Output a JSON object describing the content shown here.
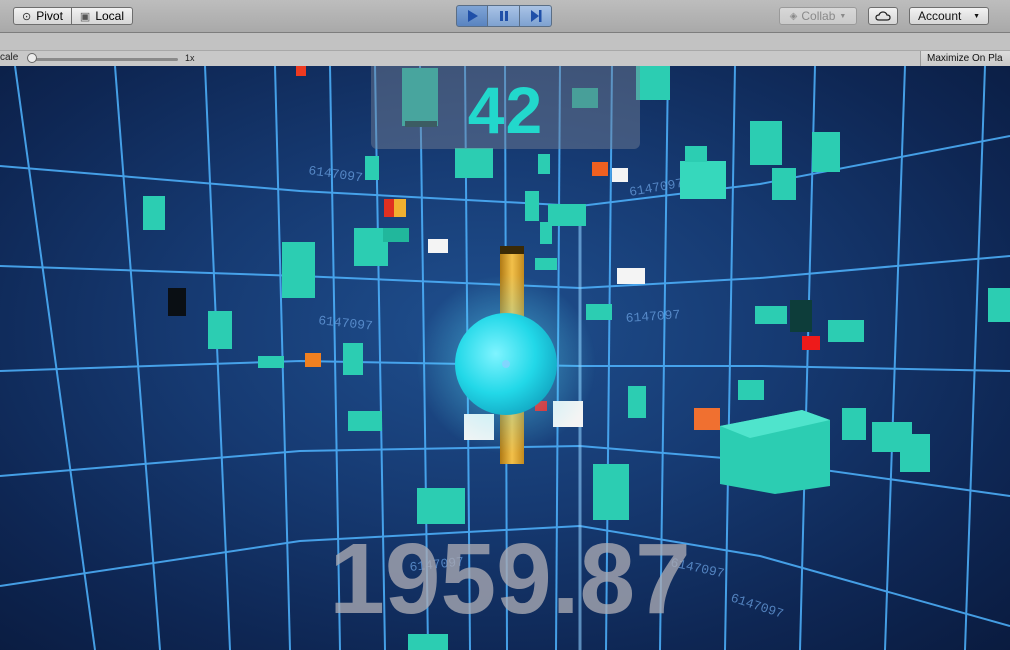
{
  "toolbar": {
    "pivot_label": "Pivot",
    "local_label": "Local",
    "play_icon": "play-icon",
    "pause_icon": "pause-icon",
    "step_icon": "step-icon",
    "collab_label": "Collab",
    "cloud_icon": "cloud-icon",
    "account_label": "Account"
  },
  "gameview": {
    "scale_label": "cale",
    "scale_value": "1x",
    "maximize_label": "Maximize On Pla"
  },
  "hud": {
    "score": "42",
    "timer": "1959.87",
    "wall_code": "6147097"
  },
  "colors": {
    "score": "#22d8cc",
    "grid": "#4fb4ff",
    "cube": "#2ccdb2",
    "ball": "#22d8e8",
    "pillar": "#e0a52a"
  }
}
